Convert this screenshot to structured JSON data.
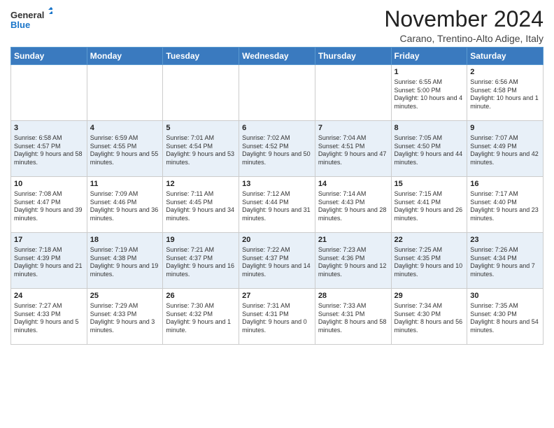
{
  "header": {
    "logo_line1": "General",
    "logo_line2": "Blue",
    "title": "November 2024",
    "subtitle": "Carano, Trentino-Alto Adige, Italy"
  },
  "days_of_week": [
    "Sunday",
    "Monday",
    "Tuesday",
    "Wednesday",
    "Thursday",
    "Friday",
    "Saturday"
  ],
  "weeks": [
    [
      {
        "day": "",
        "info": ""
      },
      {
        "day": "",
        "info": ""
      },
      {
        "day": "",
        "info": ""
      },
      {
        "day": "",
        "info": ""
      },
      {
        "day": "",
        "info": ""
      },
      {
        "day": "1",
        "info": "Sunrise: 6:55 AM\nSunset: 5:00 PM\nDaylight: 10 hours and 4 minutes."
      },
      {
        "day": "2",
        "info": "Sunrise: 6:56 AM\nSunset: 4:58 PM\nDaylight: 10 hours and 1 minute."
      }
    ],
    [
      {
        "day": "3",
        "info": "Sunrise: 6:58 AM\nSunset: 4:57 PM\nDaylight: 9 hours and 58 minutes."
      },
      {
        "day": "4",
        "info": "Sunrise: 6:59 AM\nSunset: 4:55 PM\nDaylight: 9 hours and 55 minutes."
      },
      {
        "day": "5",
        "info": "Sunrise: 7:01 AM\nSunset: 4:54 PM\nDaylight: 9 hours and 53 minutes."
      },
      {
        "day": "6",
        "info": "Sunrise: 7:02 AM\nSunset: 4:52 PM\nDaylight: 9 hours and 50 minutes."
      },
      {
        "day": "7",
        "info": "Sunrise: 7:04 AM\nSunset: 4:51 PM\nDaylight: 9 hours and 47 minutes."
      },
      {
        "day": "8",
        "info": "Sunrise: 7:05 AM\nSunset: 4:50 PM\nDaylight: 9 hours and 44 minutes."
      },
      {
        "day": "9",
        "info": "Sunrise: 7:07 AM\nSunset: 4:49 PM\nDaylight: 9 hours and 42 minutes."
      }
    ],
    [
      {
        "day": "10",
        "info": "Sunrise: 7:08 AM\nSunset: 4:47 PM\nDaylight: 9 hours and 39 minutes."
      },
      {
        "day": "11",
        "info": "Sunrise: 7:09 AM\nSunset: 4:46 PM\nDaylight: 9 hours and 36 minutes."
      },
      {
        "day": "12",
        "info": "Sunrise: 7:11 AM\nSunset: 4:45 PM\nDaylight: 9 hours and 34 minutes."
      },
      {
        "day": "13",
        "info": "Sunrise: 7:12 AM\nSunset: 4:44 PM\nDaylight: 9 hours and 31 minutes."
      },
      {
        "day": "14",
        "info": "Sunrise: 7:14 AM\nSunset: 4:43 PM\nDaylight: 9 hours and 28 minutes."
      },
      {
        "day": "15",
        "info": "Sunrise: 7:15 AM\nSunset: 4:41 PM\nDaylight: 9 hours and 26 minutes."
      },
      {
        "day": "16",
        "info": "Sunrise: 7:17 AM\nSunset: 4:40 PM\nDaylight: 9 hours and 23 minutes."
      }
    ],
    [
      {
        "day": "17",
        "info": "Sunrise: 7:18 AM\nSunset: 4:39 PM\nDaylight: 9 hours and 21 minutes."
      },
      {
        "day": "18",
        "info": "Sunrise: 7:19 AM\nSunset: 4:38 PM\nDaylight: 9 hours and 19 minutes."
      },
      {
        "day": "19",
        "info": "Sunrise: 7:21 AM\nSunset: 4:37 PM\nDaylight: 9 hours and 16 minutes."
      },
      {
        "day": "20",
        "info": "Sunrise: 7:22 AM\nSunset: 4:37 PM\nDaylight: 9 hours and 14 minutes."
      },
      {
        "day": "21",
        "info": "Sunrise: 7:23 AM\nSunset: 4:36 PM\nDaylight: 9 hours and 12 minutes."
      },
      {
        "day": "22",
        "info": "Sunrise: 7:25 AM\nSunset: 4:35 PM\nDaylight: 9 hours and 10 minutes."
      },
      {
        "day": "23",
        "info": "Sunrise: 7:26 AM\nSunset: 4:34 PM\nDaylight: 9 hours and 7 minutes."
      }
    ],
    [
      {
        "day": "24",
        "info": "Sunrise: 7:27 AM\nSunset: 4:33 PM\nDaylight: 9 hours and 5 minutes."
      },
      {
        "day": "25",
        "info": "Sunrise: 7:29 AM\nSunset: 4:33 PM\nDaylight: 9 hours and 3 minutes."
      },
      {
        "day": "26",
        "info": "Sunrise: 7:30 AM\nSunset: 4:32 PM\nDaylight: 9 hours and 1 minute."
      },
      {
        "day": "27",
        "info": "Sunrise: 7:31 AM\nSunset: 4:31 PM\nDaylight: 9 hours and 0 minutes."
      },
      {
        "day": "28",
        "info": "Sunrise: 7:33 AM\nSunset: 4:31 PM\nDaylight: 8 hours and 58 minutes."
      },
      {
        "day": "29",
        "info": "Sunrise: 7:34 AM\nSunset: 4:30 PM\nDaylight: 8 hours and 56 minutes."
      },
      {
        "day": "30",
        "info": "Sunrise: 7:35 AM\nSunset: 4:30 PM\nDaylight: 8 hours and 54 minutes."
      }
    ]
  ]
}
